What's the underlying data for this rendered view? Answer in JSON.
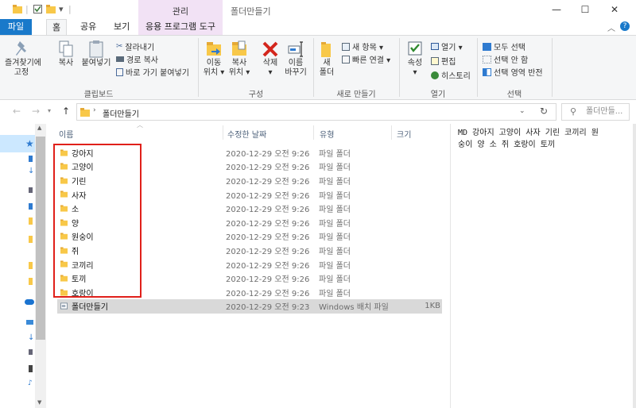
{
  "titlebar": {
    "context_tab": "관리",
    "window_title": "폴더만들기",
    "minimize": "—",
    "maximize": "☐",
    "close": "✕"
  },
  "tabs": {
    "file": "파일",
    "home": "홈",
    "share": "공유",
    "view": "보기",
    "app_tools": "응용 프로그램 도구"
  },
  "ribbon": {
    "pin": "즐겨찾기에\n고정",
    "copy": "복사",
    "paste": "붙여넣기",
    "cut": "잘라내기",
    "copy_path": "경로 복사",
    "paste_shortcut": "바로 가기 붙여넣기",
    "clipboard_group": "클립보드",
    "move_to": "이동\n위치 ▾",
    "copy_to": "복사\n위치 ▾",
    "delete": "삭제\n▾",
    "rename": "이름\n바꾸기",
    "organize_group": "구성",
    "new_folder": "새\n폴더",
    "new_item": "새 항목 ▾",
    "easy_access": "빠른 연결 ▾",
    "new_group": "새로 만들기",
    "properties": "속성\n▾",
    "open": "열기 ▾",
    "edit": "편집",
    "history": "히스토리",
    "open_group": "열기",
    "select_all": "모두 선택",
    "select_none": "선택 안 함",
    "invert_selection": "선택 영역 반전",
    "select_group": "선택"
  },
  "nav": {
    "path": "폴더만들기",
    "search_placeholder": "폴더만들..."
  },
  "columns": {
    "name": "이름",
    "date": "수정한 날짜",
    "type": "유형",
    "size": "크기"
  },
  "files": [
    {
      "name": "강아지",
      "date": "2020-12-29 오전 9:26",
      "type": "파일 폴더",
      "size": ""
    },
    {
      "name": "고양이",
      "date": "2020-12-29 오전 9:26",
      "type": "파일 폴더",
      "size": ""
    },
    {
      "name": "기린",
      "date": "2020-12-29 오전 9:26",
      "type": "파일 폴더",
      "size": ""
    },
    {
      "name": "사자",
      "date": "2020-12-29 오전 9:26",
      "type": "파일 폴더",
      "size": ""
    },
    {
      "name": "소",
      "date": "2020-12-29 오전 9:26",
      "type": "파일 폴더",
      "size": ""
    },
    {
      "name": "양",
      "date": "2020-12-29 오전 9:26",
      "type": "파일 폴더",
      "size": ""
    },
    {
      "name": "원숭이",
      "date": "2020-12-29 오전 9:26",
      "type": "파일 폴더",
      "size": ""
    },
    {
      "name": "쥐",
      "date": "2020-12-29 오전 9:26",
      "type": "파일 폴더",
      "size": ""
    },
    {
      "name": "코끼리",
      "date": "2020-12-29 오전 9:26",
      "type": "파일 폴더",
      "size": ""
    },
    {
      "name": "토끼",
      "date": "2020-12-29 오전 9:26",
      "type": "파일 폴더",
      "size": ""
    },
    {
      "name": "호랑이",
      "date": "2020-12-29 오전 9:26",
      "type": "파일 폴더",
      "size": ""
    },
    {
      "name": "폴더만들기",
      "date": "2020-12-29 오전 9:23",
      "type": "Windows 배치 파일",
      "size": "1KB"
    }
  ],
  "preview": {
    "line1": "MD 강아지 고양이 사자 기린 코끼리 원",
    "line2": "숭이 양 소 쥐 호랑이 토끼"
  },
  "colors": {
    "accent": "#1979ca",
    "context_tab": "#f2e2f5",
    "highlight_box": "#e0201a",
    "folder": "#f8c849"
  }
}
